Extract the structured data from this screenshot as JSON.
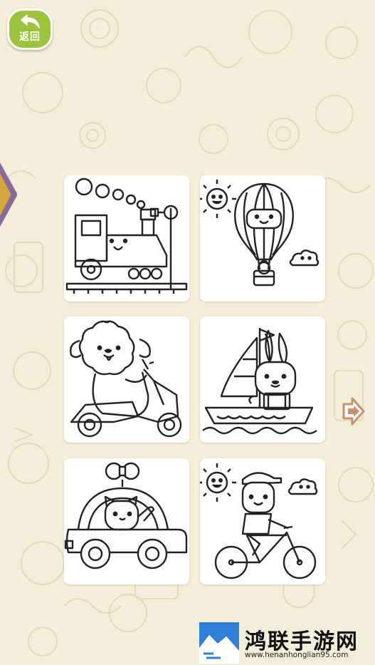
{
  "header": {
    "back_label": "返回"
  },
  "gallery": {
    "cards": [
      {
        "subject": "train"
      },
      {
        "subject": "hot-air-balloon"
      },
      {
        "subject": "puppy-on-scooter"
      },
      {
        "subject": "bunny-on-sailboat"
      },
      {
        "subject": "kitten-in-car"
      },
      {
        "subject": "boy-on-bicycle"
      }
    ]
  },
  "watermark": {
    "title": "鸿联手游网",
    "url": "www.henanhonglian95.com"
  },
  "colors": {
    "accent": "#9bc33c",
    "background": "#f3eeda",
    "line": "#222222",
    "arrow": "#c8916e"
  },
  "icons": {
    "back": "back-arrow-icon",
    "next": "chevron-right-icon"
  }
}
